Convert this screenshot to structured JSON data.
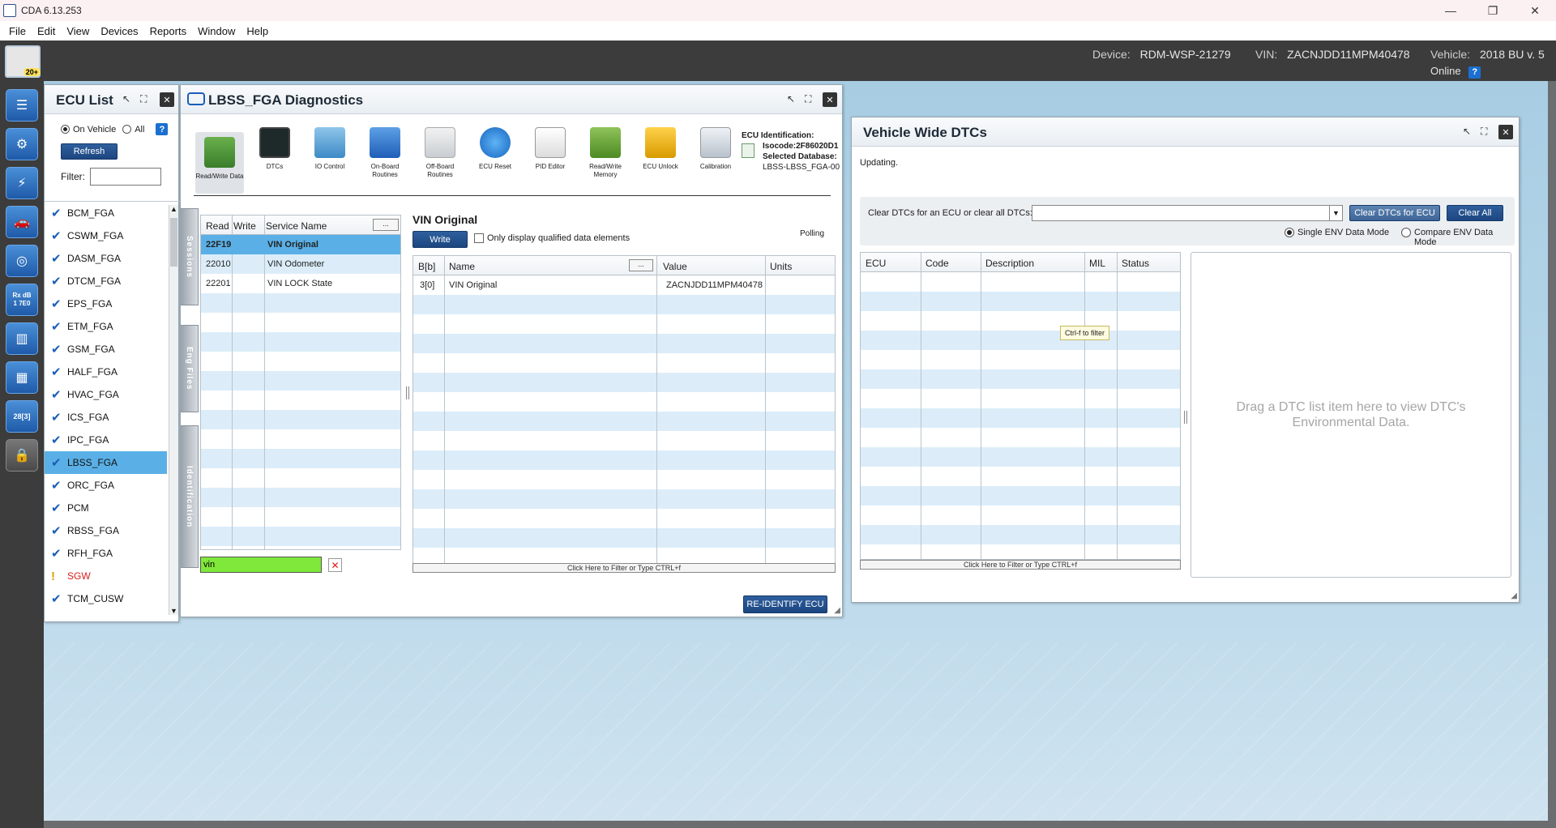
{
  "window": {
    "title": "CDA 6.13.253",
    "minimize": "—",
    "maximize": "❐",
    "close": "✕"
  },
  "menu": [
    "File",
    "Edit",
    "View",
    "Devices",
    "Reports",
    "Window",
    "Help"
  ],
  "header": {
    "logo_badge": "20+",
    "device_label": "Device:",
    "device_value": "RDM-WSP-21279",
    "vin_label": "VIN:",
    "vin_value": "ZACNJDD11MPM40478",
    "vehicle_label": "Vehicle:",
    "vehicle_value": "2018 BU v. 5",
    "status": "Online",
    "help": "?"
  },
  "toolbar_icons": [
    "menu-icon",
    "vehicle-scan-icon",
    "flash-icon",
    "vehicle-icon",
    "network-icon",
    "data-bus-icon",
    "layout-icon",
    "dashboard-icon",
    "vehicle-config-icon",
    "lock-icon"
  ],
  "toolbar_glyphs": {
    "menu": "☰",
    "scan": "⚙",
    "flash": "⚡",
    "vehicle": "🚗",
    "network": "◎",
    "bus": "Rx dB",
    "bus2": "1 7E0",
    "layout": "▥",
    "dash": "▦",
    "vconf": "28[3]",
    "lock": "🔒"
  },
  "ecu_list": {
    "title": "ECU List",
    "on_vehicle": "On Vehicle",
    "all": "All",
    "help": "?",
    "refresh": "Refresh",
    "filter_label": "Filter:",
    "filter_value": "",
    "items": [
      {
        "name": "BCM_FGA",
        "mark": "✔"
      },
      {
        "name": "CSWM_FGA",
        "mark": "✔"
      },
      {
        "name": "DASM_FGA",
        "mark": "✔"
      },
      {
        "name": "DTCM_FGA",
        "mark": "✔"
      },
      {
        "name": "EPS_FGA",
        "mark": "✔"
      },
      {
        "name": "ETM_FGA",
        "mark": "✔"
      },
      {
        "name": "GSM_FGA",
        "mark": "✔"
      },
      {
        "name": "HALF_FGA",
        "mark": "✔"
      },
      {
        "name": "HVAC_FGA",
        "mark": "✔"
      },
      {
        "name": "ICS_FGA",
        "mark": "✔"
      },
      {
        "name": "IPC_FGA",
        "mark": "✔"
      },
      {
        "name": "LBSS_FGA",
        "mark": "✔"
      },
      {
        "name": "ORC_FGA",
        "mark": "✔"
      },
      {
        "name": "PCM",
        "mark": "✔"
      },
      {
        "name": "RBSS_FGA",
        "mark": "✔"
      },
      {
        "name": "RFH_FGA",
        "mark": "✔"
      },
      {
        "name": "SGW",
        "mark": "!"
      },
      {
        "name": "TCM_CUSW",
        "mark": "✔"
      }
    ]
  },
  "diag": {
    "title": "LBSS_FGA Diagnostics",
    "tools": [
      {
        "label": "Read/Write Data"
      },
      {
        "label": "DTCs"
      },
      {
        "label": "IO Control"
      },
      {
        "label": "On-Board Routines"
      },
      {
        "label": "Off-Board Routines"
      },
      {
        "label": "ECU Reset"
      },
      {
        "label": "PID Editor"
      },
      {
        "label": "Read/Write Memory"
      },
      {
        "label": "ECU Unlock"
      },
      {
        "label": "Calibration"
      }
    ],
    "ecu_ident_title": "ECU Identification:",
    "isocode": "Isocode:2F86020D1",
    "selected_db": "Selected Database:",
    "db_value": "LBSS-LBSS_FGA-00",
    "side_tabs": [
      "Sessions",
      "Eng Files",
      "Identification"
    ],
    "services": {
      "headers": [
        "Read",
        "Write",
        "Service Name",
        "..."
      ],
      "rows": [
        {
          "read": "22F19",
          "name": "VIN Original"
        },
        {
          "read": "22010",
          "name": "VIN Odometer"
        },
        {
          "read": "22201",
          "name": "VIN LOCK State"
        }
      ],
      "filter_value": "vin",
      "clear": "✕"
    },
    "detail": {
      "title": "VIN Original",
      "write": "Write",
      "qualified": "Only display qualified data elements",
      "polling": "Polling",
      "headers": [
        "B[b]",
        "Name",
        "...",
        "Value",
        "Units"
      ],
      "rows": [
        {
          "b": "3[0]",
          "name": "VIN Original",
          "value": "ZACNJDD11MPM40478",
          "units": ""
        }
      ],
      "filter_hint": "Click Here to Filter or Type CTRL+f"
    },
    "reidentify": "RE-IDENTIFY ECU"
  },
  "dtc": {
    "title": "Vehicle Wide DTCs",
    "status": "Updating.",
    "clear_label": "Clear DTCs for an ECU or clear all DTCs:",
    "clear_ecu": "Clear DTCs for ECU",
    "clear_all": "Clear All",
    "single_mode": "Single ENV Data Mode",
    "compare_mode": "Compare ENV Data Mode",
    "headers": [
      "ECU",
      "Code",
      "Description",
      "MIL",
      "Status"
    ],
    "tooltip": "Ctrl-f to filter",
    "filter_hint": "Click Here to Filter or Type CTRL+f",
    "env_hint": "Drag a DTC list item here to view DTC's Environmental Data."
  }
}
